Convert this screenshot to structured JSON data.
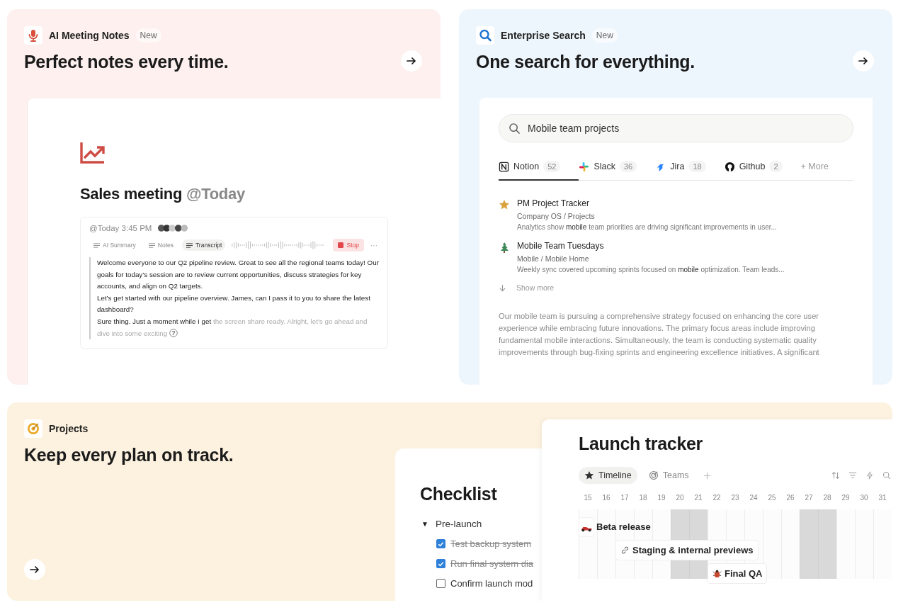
{
  "meeting_notes": {
    "label": "AI Meeting Notes",
    "badge": "New",
    "headline": "Perfect notes every time.",
    "document": {
      "title": "Sales meeting",
      "title_mention": "@Today",
      "timestamp": "@Today 3:45 PM",
      "tabs": [
        {
          "label": "AI Summary",
          "selected": false
        },
        {
          "label": "Notes",
          "selected": false
        },
        {
          "label": "Transcript",
          "selected": true
        }
      ],
      "stop_button": "Stop",
      "more": "···",
      "transcript": [
        {
          "segments": [
            {
              "text": "Welcome everyone to our Q2 pipeline review. Great to see all the regional teams today! Our goals for today’s session are to review current opportunities, discuss strategies for key accounts, and align on Q2 targets.",
              "faded": false
            }
          ]
        },
        {
          "segments": [
            {
              "text": "Let’s get started with our pipeline overview. James, can I pass it to you to share the latest dashboard?",
              "faded": false
            }
          ]
        },
        {
          "segments": [
            {
              "text": "Sure thing. Just a moment while I get",
              "faded": false
            },
            {
              "text": " the screen share ready. Alright, let’s go ahead and dive into some exciting",
              "faded": true
            }
          ]
        }
      ]
    }
  },
  "enterprise_search": {
    "label": "Enterprise Search",
    "badge": "New",
    "headline": "One search for everything.",
    "search": {
      "value": "Mobile team projects"
    },
    "sources": [
      {
        "name": "Notion",
        "count": "52",
        "selected": true
      },
      {
        "name": "Slack",
        "count": "36",
        "selected": false
      },
      {
        "name": "Jira",
        "count": "18",
        "selected": false
      },
      {
        "name": "Github",
        "count": "2",
        "selected": false
      }
    ],
    "more_sources": "+ More",
    "results": [
      {
        "title": "PM Project Tracker",
        "path": "Company OS / Projects",
        "snippet": "Analytics show **mobile** team priorities are driving significant improvements in user..."
      },
      {
        "title": "Mobile Team Tuesdays",
        "path": "Mobile / Mobile Home",
        "snippet": "Weekly sync covered upcoming sprints focused on **mobile** optimization. Team leads..."
      }
    ],
    "show_more": "Show more",
    "summary": "Our mobile team is pursuing a comprehensive strategy focused on enhancing the core user experience while embracing future innovations. The primary focus areas include improving fundamental mobile interactions. Simultaneously, the team is conducting systematic quality improvements through bug-fixing sprints and engineering excellence initiatives. A significant"
  },
  "projects": {
    "label": "Projects",
    "headline": "Keep every plan on track.",
    "checklist": {
      "title": "Checklist",
      "toggle": "▼",
      "group": "Pre-launch",
      "items": [
        {
          "label": "Test backup system",
          "checked": true
        },
        {
          "label": "Run final system dia",
          "checked": true
        },
        {
          "label": "Confirm launch mod",
          "checked": false
        }
      ]
    },
    "tracker": {
      "title": "Launch tracker",
      "views": [
        {
          "label": "Timeline",
          "selected": true
        },
        {
          "label": "Teams",
          "selected": false
        }
      ],
      "dates": [
        {
          "day": "15",
          "shaded": false
        },
        {
          "day": "16",
          "shaded": false
        },
        {
          "day": "17",
          "shaded": false
        },
        {
          "day": "18",
          "shaded": false
        },
        {
          "day": "19",
          "shaded": false
        },
        {
          "day": "20",
          "shaded": true
        },
        {
          "day": "21",
          "shaded": true
        },
        {
          "day": "22",
          "shaded": false
        },
        {
          "day": "23",
          "shaded": false
        },
        {
          "day": "24",
          "shaded": false
        },
        {
          "day": "25",
          "shaded": false
        },
        {
          "day": "26",
          "shaded": false
        },
        {
          "day": "27",
          "shaded": true
        },
        {
          "day": "28",
          "shaded": true
        },
        {
          "day": "29",
          "shaded": false
        },
        {
          "day": "30",
          "shaded": false
        },
        {
          "day": "31",
          "shaded": false
        }
      ],
      "items": [
        {
          "label": "Beta release"
        },
        {
          "label": "Staging & internal previews"
        },
        {
          "label": "Final QA"
        }
      ]
    }
  }
}
